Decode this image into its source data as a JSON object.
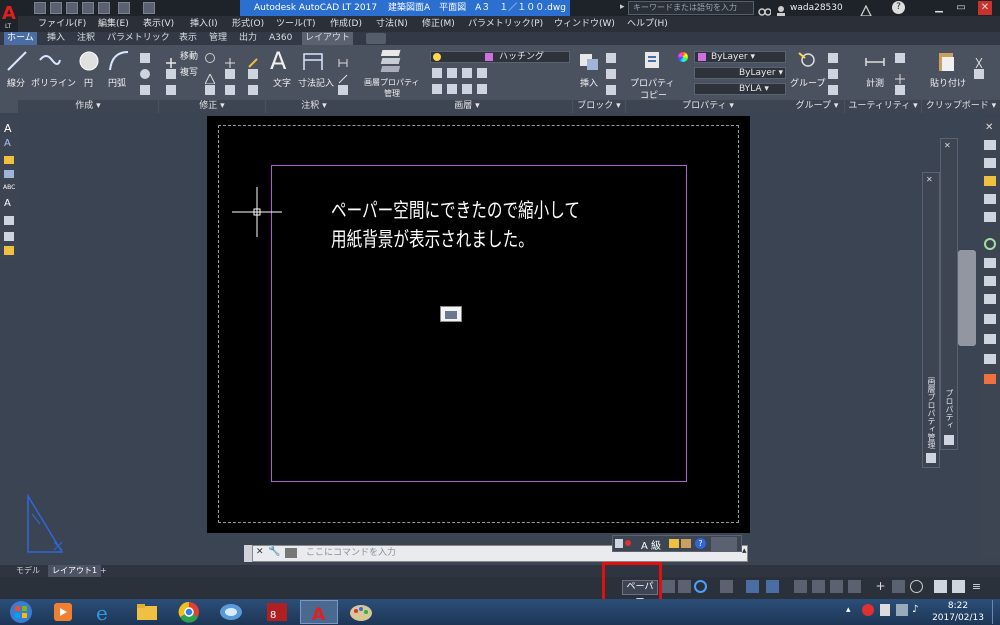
{
  "title_bar": {
    "app_title": "Autodesk AutoCAD LT 2017",
    "file_title": "建築図面A　平面図　A３　１／１００.dwg",
    "search_placeholder": "キーワードまたは語句を入力",
    "user": "wada28530"
  },
  "menu": [
    "ファイル(F)",
    "編集(E)",
    "表示(V)",
    "挿入(I)",
    "形式(O)",
    "ツール(T)",
    "作成(D)",
    "寸法(N)",
    "修正(M)",
    "パラメトリック(P)",
    "ウィンドウ(W)",
    "ヘルプ(H)"
  ],
  "ribbon_tabs": [
    "ホーム",
    "挿入",
    "注釈",
    "パラメトリック",
    "表示",
    "管理",
    "出力",
    "A360",
    "レイアウト"
  ],
  "ribbon": {
    "draw": {
      "line": "線分",
      "polyline": "ポリライン",
      "circle": "円",
      "arc": "円弧",
      "title": "作成"
    },
    "modify": {
      "move": "移動",
      "copy": "複写",
      "title": "修正"
    },
    "annotation": {
      "text": "文字",
      "dimension": "寸法記入",
      "title": "注釈"
    },
    "layers": {
      "layer_props": "画層プロパティ",
      "manage": "管理",
      "current_layer": "ハッチング",
      "title": "画層"
    },
    "block": {
      "insert": "挿入",
      "title": "ブロック"
    },
    "properties": {
      "match": "プロパティ",
      "copy": "コピー",
      "color": "ByLayer",
      "linetype": "ByLayer",
      "lineweight": "BYLA",
      "title": "プロパティ"
    },
    "groups": {
      "group": "グループ",
      "title": "グループ"
    },
    "utilities": {
      "measure": "計測",
      "title": "ユーティリティ"
    },
    "clipboard": {
      "paste": "貼り付け",
      "title": "クリップボード"
    }
  },
  "canvas": {
    "mtext_line1": "ペーパー空間にできたので縮小して",
    "mtext_line2": "用紙背景が表示されました。"
  },
  "palettes": {
    "layer_palette": "画層プロパティ管理",
    "properties_palette": "プロパティ"
  },
  "command_line": {
    "placeholder": "ここにコマンドを入力"
  },
  "layout_tabs": {
    "model": "モデル",
    "layout1": "レイアウト1"
  },
  "status_bar": {
    "space_toggle": "ペーパー",
    "scale_label": "A 級"
  },
  "taskbar": {
    "time": "8:22",
    "date": "2017/02/13"
  },
  "colors": {
    "viewport_border": "#b05dd0",
    "highlight": "#e01010",
    "title_active": "#2b6fd1"
  }
}
